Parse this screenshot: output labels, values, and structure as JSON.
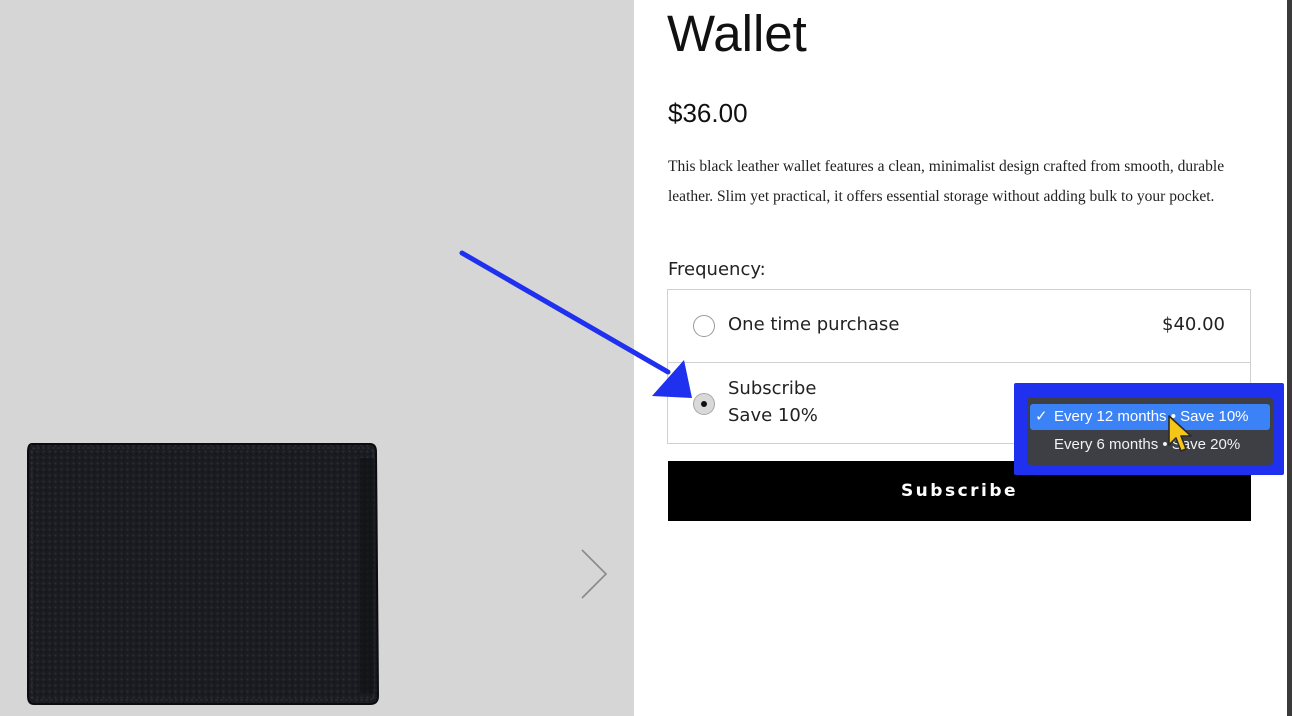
{
  "product": {
    "title": "Wallet",
    "price": "$36.00",
    "description": "This black leather wallet features a clean, minimalist design crafted from smooth, durable leather. Slim yet practical, it offers essential storage without adding bulk to your pocket."
  },
  "frequency": {
    "label": "Frequency:",
    "options": [
      {
        "label": "One time purchase",
        "price": "$40.00",
        "selected": false
      },
      {
        "label": "Subscribe",
        "sublabel": "Save 10%",
        "selected": true
      }
    ]
  },
  "subscribe_button": {
    "label": "Subscribe"
  },
  "frequency_dropdown": {
    "check_glyph": "✓",
    "options": [
      {
        "label": "Every 12 months • Save 10%",
        "selected": true
      },
      {
        "label": "Every 6 months • Save 20%",
        "selected": false
      }
    ]
  },
  "colors": {
    "gallery_bg": "#d6d6d6",
    "annotation_blue": "#1f30ee",
    "menu_bg": "#3d3f45",
    "menu_active": "#3b82f6",
    "button_bg": "#000000"
  },
  "icons": {
    "gallery_next": "chevron-right-icon",
    "annotation": "arrow-icon",
    "pointer": "cursor-icon"
  }
}
